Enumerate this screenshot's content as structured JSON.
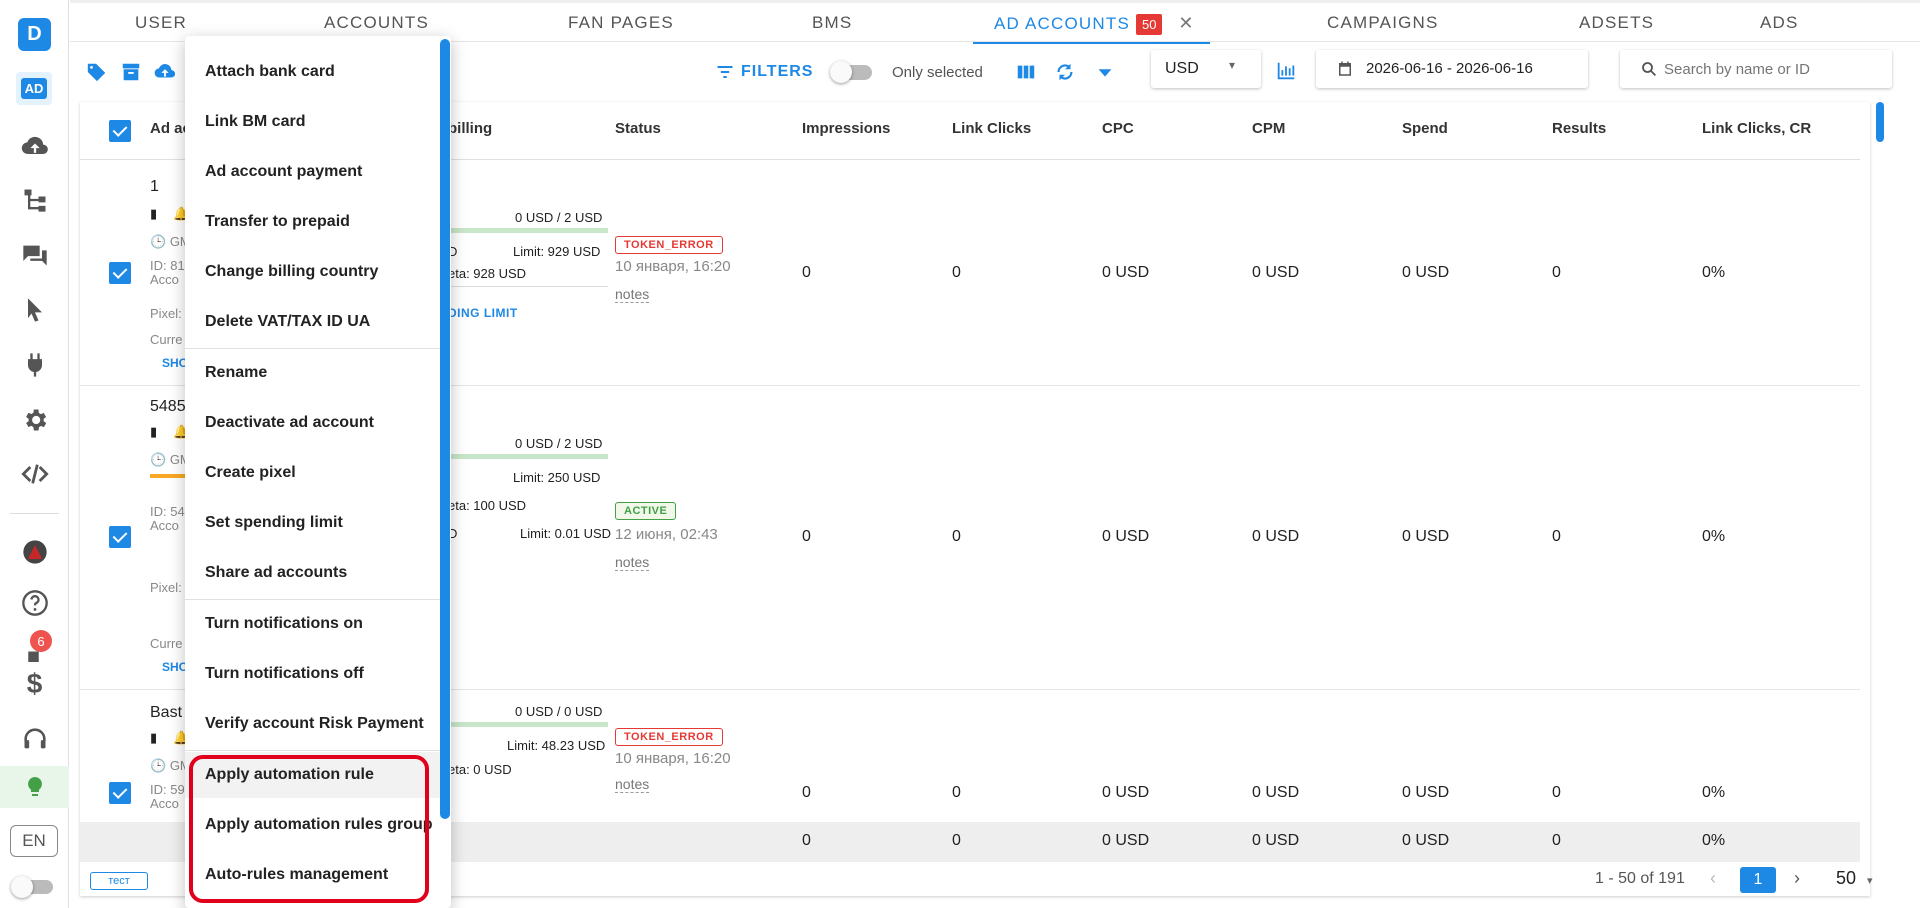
{
  "sidebar": {
    "logo": "D",
    "ad_label": "AD",
    "notification_count": "6",
    "language": "EN",
    "icons": [
      "cloud-upload-icon",
      "hierarchy-icon",
      "chat-icon",
      "cursor-icon",
      "plug-icon",
      "gear-icon",
      "code-icon",
      "avatar",
      "help-icon",
      "notification-icon",
      "dollar-icon",
      "headset-icon",
      "lightbulb-icon"
    ]
  },
  "tabs": [
    {
      "label": "USER",
      "active": false
    },
    {
      "label": "ACCOUNTS",
      "active": false
    },
    {
      "label": "FAN PAGES",
      "active": false
    },
    {
      "label": "BMS",
      "active": false
    },
    {
      "label": "AD ACCOUNTS",
      "active": true,
      "count": "50"
    },
    {
      "label": "CAMPAIGNS",
      "active": false
    },
    {
      "label": "ADSETS",
      "active": false
    },
    {
      "label": "ADS",
      "active": false
    }
  ],
  "toolbar": {
    "filters_label": "FILTERS",
    "only_selected_label": "Only selected",
    "currency": "USD",
    "date_range": "2026-06-16 - 2026-06-16",
    "search_placeholder": "Search by name or ID"
  },
  "table": {
    "headers": [
      "Ad ac",
      "billing",
      "Status",
      "Impressions",
      "Link Clicks",
      "CPC",
      "CPM",
      "Spend",
      "Results",
      "Link Clicks, CR"
    ],
    "rows": [
      {
        "name": "1",
        "id": "ID: 81",
        "account": "Acco",
        "pixel": "Pixel:",
        "currency": "Curre",
        "show": "SHO",
        "gm": "GM",
        "billing_top": "0 USD / 2 USD",
        "billing_d": "D",
        "limit": "Limit: 929 USD",
        "meta": "eta: 928 USD",
        "spending_limit": "DING LIMIT",
        "status": "TOKEN_ERROR",
        "status_type": "error",
        "date": "10 января, 16:20",
        "notes": "notes",
        "impressions": "0",
        "link_clicks": "0",
        "cpc": "0 USD",
        "cpm": "0 USD",
        "spend": "0 USD",
        "results": "0",
        "cr": "0%"
      },
      {
        "name": "5485",
        "id": "ID: 54",
        "account": "Acco",
        "pixel": "Pixel:",
        "currency": "Curre",
        "show": "SHO",
        "gm": "GM",
        "billing_top": "0 USD / 2 USD",
        "billing_d": "D",
        "limit": "Limit: 250 USD",
        "meta": "eta: 100 USD",
        "limit2_d": "D",
        "limit2": "Limit: 0.01 USD",
        "status": "ACTIVE",
        "status_type": "active",
        "date": "12 июня, 02:43",
        "notes": "notes",
        "impressions": "0",
        "link_clicks": "0",
        "cpc": "0 USD",
        "cpm": "0 USD",
        "spend": "0 USD",
        "results": "0",
        "cr": "0%"
      },
      {
        "name": "Bast",
        "id": "ID: 59",
        "account": "Acco",
        "gm": "GM",
        "billing_top": "0 USD / 0 USD",
        "billing_d": "D",
        "limit": "Limit: 48.23 USD",
        "meta": "eta: 0 USD",
        "status": "TOKEN_ERROR",
        "status_type": "error",
        "date": "10 января, 16:20",
        "notes": "notes",
        "impressions": "0",
        "link_clicks": "0",
        "cpc": "0 USD",
        "cpm": "0 USD",
        "spend": "0 USD",
        "results": "0",
        "cr": "0%"
      }
    ],
    "totals": {
      "impressions": "0",
      "link_clicks": "0",
      "cpc": "0 USD",
      "cpm": "0 USD",
      "spend": "0 USD",
      "results": "0",
      "cr": "0%"
    }
  },
  "footer": {
    "tag": "тест",
    "range": "1 - 50 of 191",
    "page": "1",
    "per_page": "50"
  },
  "menu": {
    "items": [
      "Attach bank card",
      "Link BM card",
      "Ad account payment",
      "Transfer to prepaid",
      "Change billing country",
      "Delete VAT/TAX ID UA",
      "Rename",
      "Deactivate ad account",
      "Create pixel",
      "Set spending limit",
      "Share ad accounts",
      "Turn notifications on",
      "Turn notifications off",
      "Verify account Risk Payment",
      "Apply automation rule",
      "Apply automation rules group",
      "Auto-rules management"
    ]
  },
  "colors": {
    "accent": "#1e88e5",
    "error": "#e53935",
    "active": "#43a047",
    "highlight": "#e0001b"
  }
}
